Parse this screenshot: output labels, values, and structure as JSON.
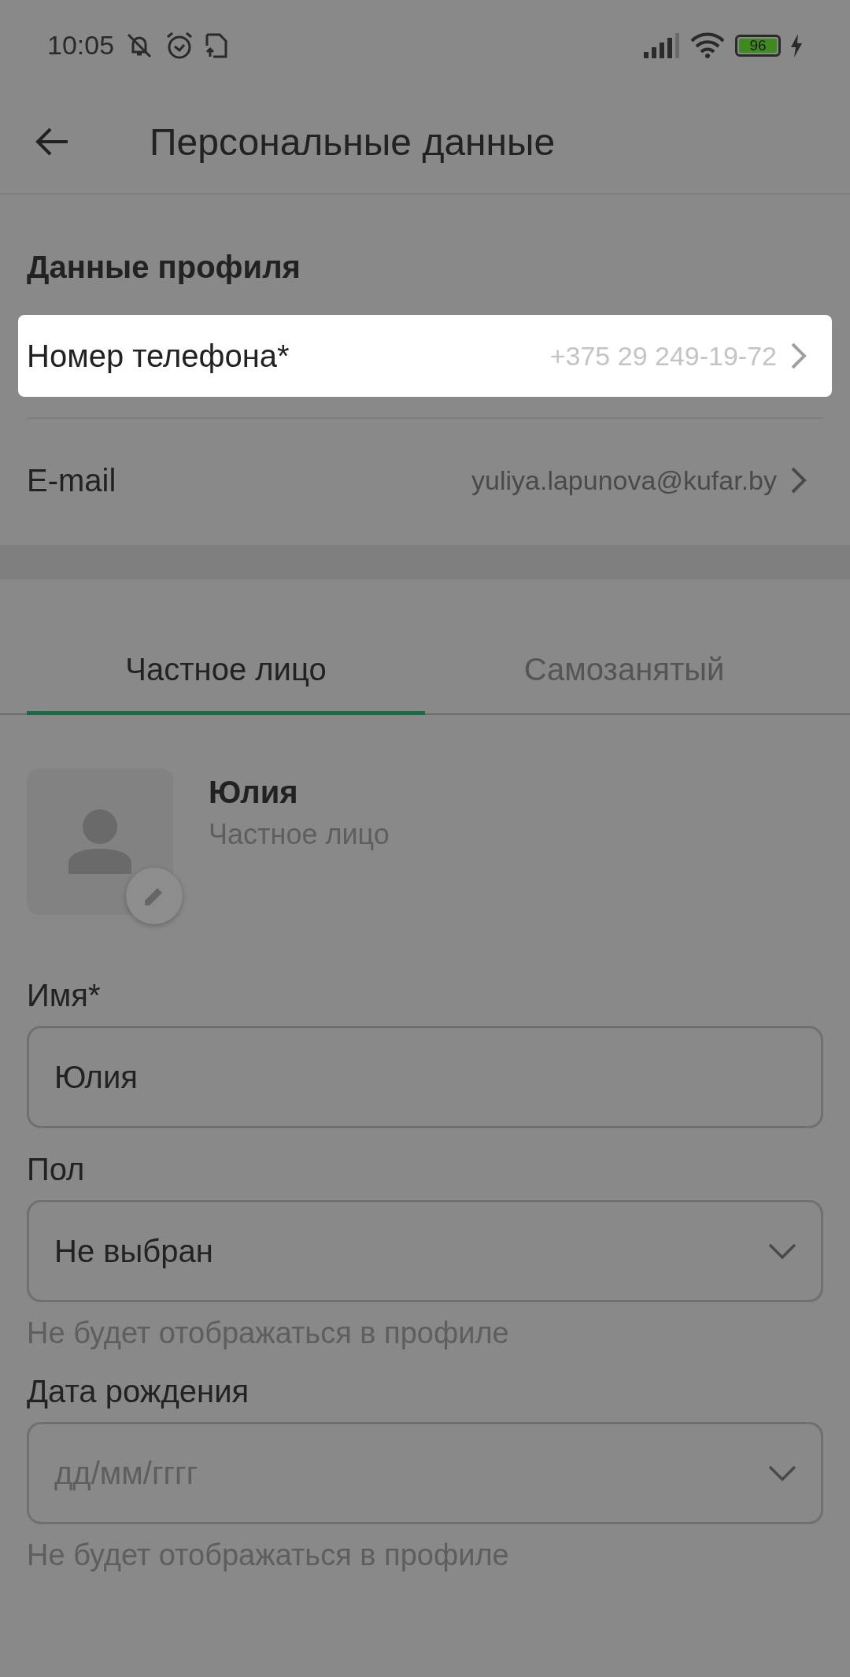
{
  "status_bar": {
    "time": "10:05",
    "battery": "96"
  },
  "header": {
    "title": "Персональные данные"
  },
  "profile_section": {
    "title": "Данные профиля",
    "rows": [
      {
        "label": "Номер телефона*",
        "value": "+375 29 249-19-72",
        "highlighted": true
      },
      {
        "label": "E-mail",
        "value": "yuliya.lapunova@kufar.by",
        "highlighted": false
      }
    ]
  },
  "tabs": [
    {
      "label": "Частное лицо",
      "selected": true
    },
    {
      "label": "Самозанятый",
      "selected": false
    }
  ],
  "profile": {
    "name": "Юлия",
    "type": "Частное лицо"
  },
  "form": [
    {
      "kind": "text",
      "label": "Имя*",
      "value": "Юлия"
    },
    {
      "kind": "select",
      "label": "Пол",
      "value": "Не выбран",
      "hint": "Не будет отображаться в профиле"
    },
    {
      "kind": "select",
      "label": "Дата рождения",
      "placeholder": "дд/мм/гггг",
      "hint": "Не будет отображаться в профиле"
    }
  ]
}
